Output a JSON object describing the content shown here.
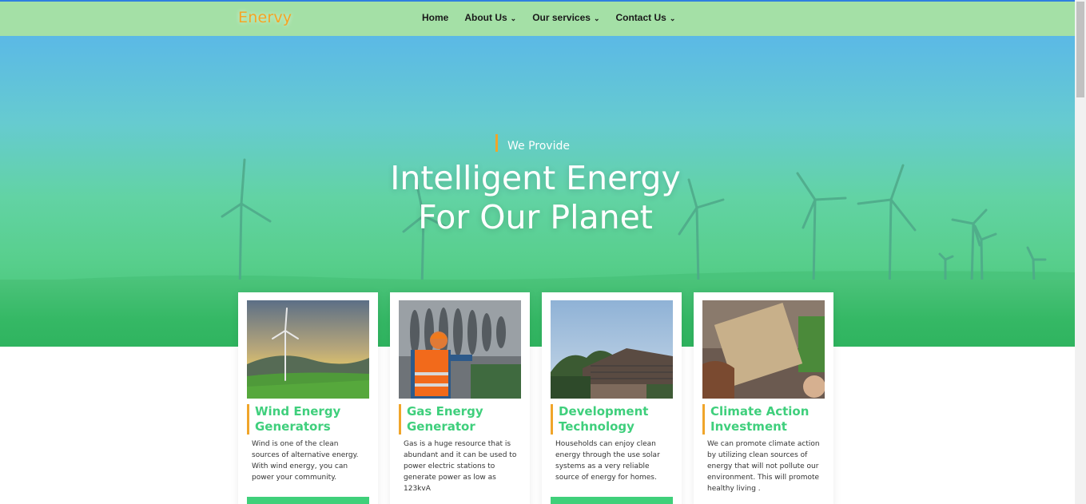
{
  "brand": {
    "logo_text": "Enervy",
    "logo_color": "#f5a524",
    "accent_color": "#3fcf7c",
    "bar_accent": "#f0a52a"
  },
  "nav": {
    "items": [
      {
        "label": "Home",
        "has_dropdown": false
      },
      {
        "label": "About Us",
        "has_dropdown": true
      },
      {
        "label": "Our services",
        "has_dropdown": true
      },
      {
        "label": "Contact Us",
        "has_dropdown": true
      }
    ]
  },
  "hero": {
    "eyebrow": "We Provide",
    "headline_line1": "Intelligent Energy",
    "headline_line2": "For Our Planet"
  },
  "cards": [
    {
      "title": "Wind Energy Generators",
      "description": "Wind is one of the clean sources of alternative energy. With wind energy, you can power your community.",
      "image": "wind-turbine-photo"
    },
    {
      "title": "Gas Energy Generator",
      "description": "Gas is a huge resource that is abundant and it can be used to power electric stations to generate power as low as 123kvA",
      "image": "gas-turbine-worker-photo"
    },
    {
      "title": "Development Technology",
      "description": "Households can enjoy clean energy through the use solar systems as a very reliable source of energy for homes.",
      "image": "solar-roof-photo"
    },
    {
      "title": "Climate Action Investment",
      "description": "We can promote climate action by utilizing clean sources of energy that will not pollute our environment. This will  promote healthy living .",
      "image": "save-our-future-protest-photo"
    }
  ],
  "icons": {
    "dropdown": "chevron-down-icon"
  }
}
